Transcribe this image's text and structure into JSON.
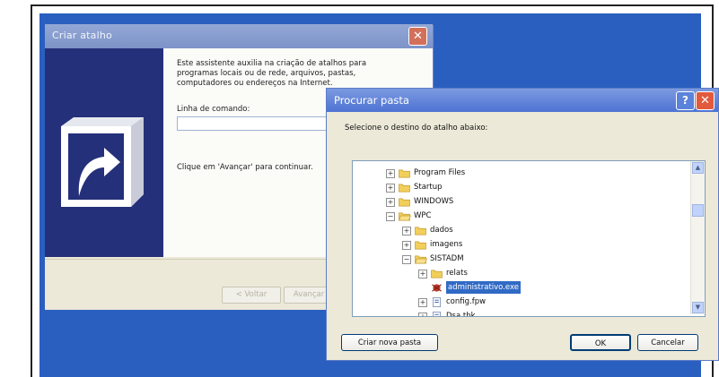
{
  "wizard": {
    "title": "Criar atalho",
    "close_symbol": "✕",
    "intro": "Este assistente auxilia na criação de atalhos para programas locais ou de rede, arquivos, pastas, computadores ou endereços na Internet.",
    "command_label": "Linha de comando:",
    "command_value": "",
    "hint": "Clique em 'Avançar' para continuar.",
    "buttons": {
      "back": "< Voltar",
      "next": "Avançar >"
    },
    "banner_icon": "shortcut-arrow-icon"
  },
  "dialog": {
    "title": "Procurar pasta",
    "help_symbol": "?",
    "close_symbol": "✕",
    "prompt": "Selecione o destino do atalho abaixo:",
    "tree": [
      {
        "label": "Program Files",
        "indent": 0,
        "expander": "+",
        "icon": "folder-icon"
      },
      {
        "label": "Startup",
        "indent": 0,
        "expander": "+",
        "icon": "folder-icon"
      },
      {
        "label": "WINDOWS",
        "indent": 0,
        "expander": "+",
        "icon": "folder-icon"
      },
      {
        "label": "WPC",
        "indent": 0,
        "expander": "−",
        "icon": "folder-open-icon"
      },
      {
        "label": "dados",
        "indent": 1,
        "expander": "+",
        "icon": "folder-icon"
      },
      {
        "label": "imagens",
        "indent": 1,
        "expander": "+",
        "icon": "folder-icon"
      },
      {
        "label": "SISTADM",
        "indent": 1,
        "expander": "−",
        "icon": "folder-open-icon"
      },
      {
        "label": "relats",
        "indent": 2,
        "expander": "+",
        "icon": "folder-icon"
      },
      {
        "label": "administrativo.exe",
        "indent": 2,
        "expander": "",
        "icon": "exe-file-icon",
        "selected": true
      },
      {
        "label": "config.fpw",
        "indent": 2,
        "expander": "+",
        "icon": "file-icon"
      },
      {
        "label": "Dsa.tbk",
        "indent": 2,
        "expander": "+",
        "icon": "file-icon"
      }
    ],
    "buttons": {
      "new_folder": "Criar nova pasta",
      "ok": "OK",
      "cancel": "Cancelar"
    }
  },
  "colors": {
    "desktop": "#2a5fc0",
    "selection": "#316ac5",
    "banner": "#25307a"
  }
}
